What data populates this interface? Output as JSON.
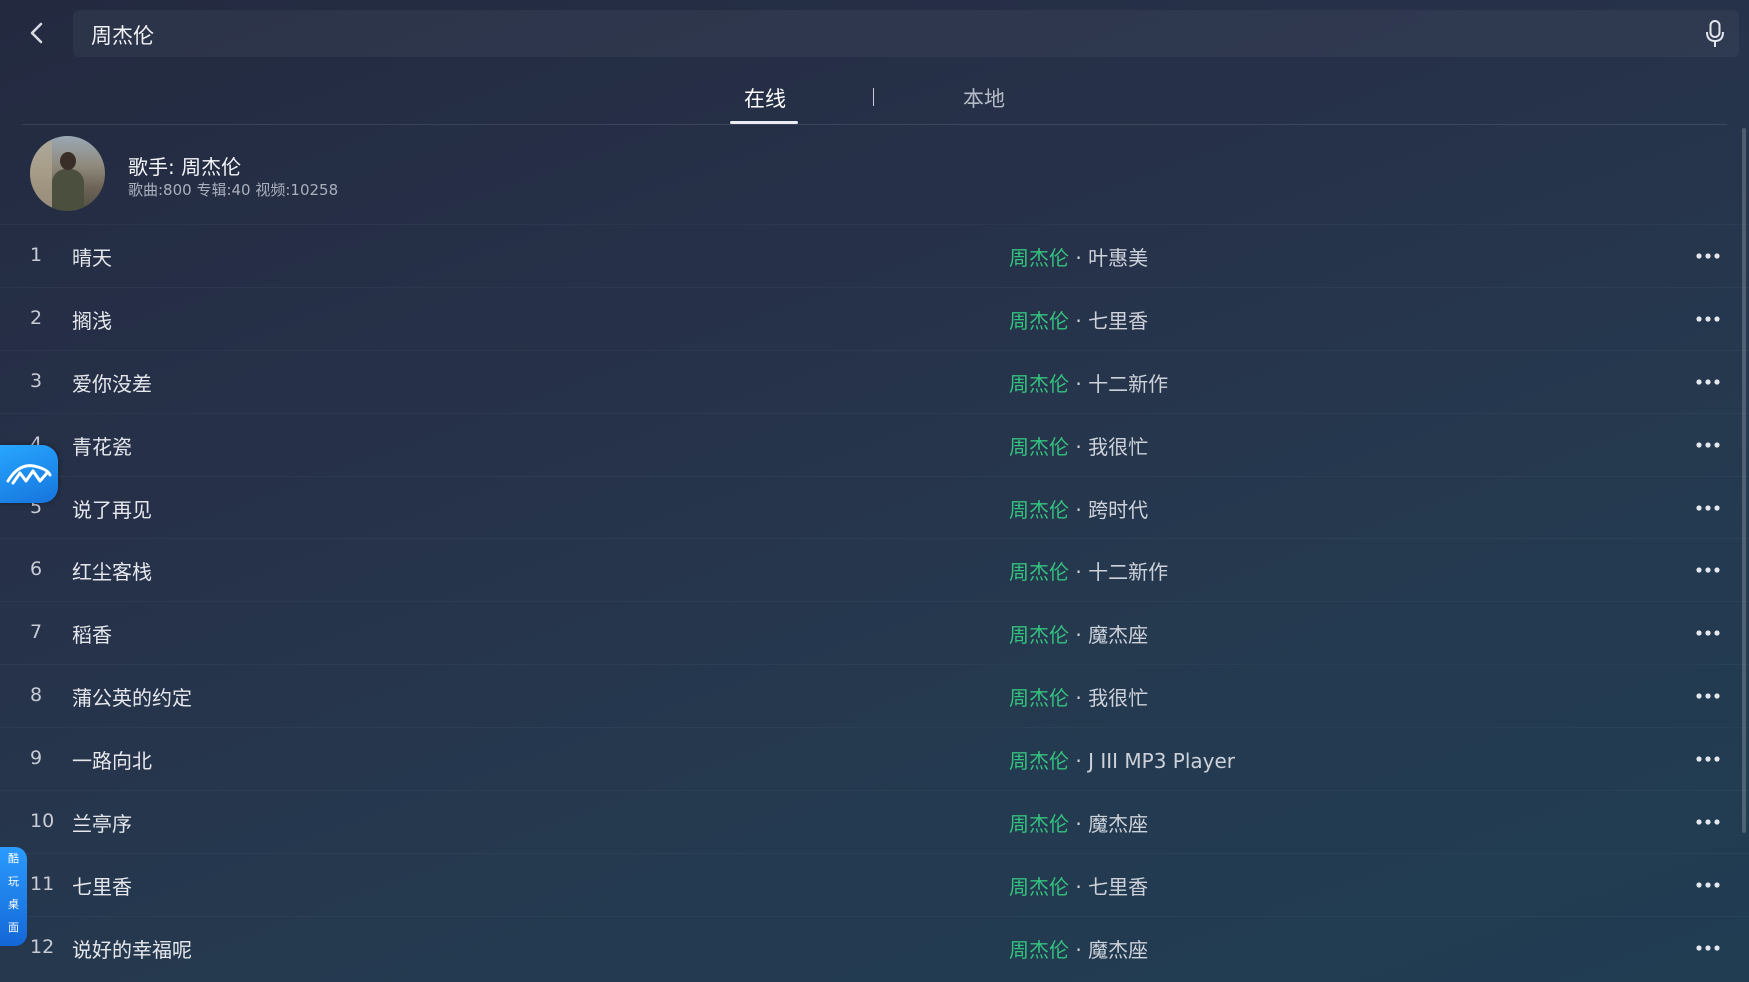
{
  "search": {
    "query": "周杰伦"
  },
  "tabs": [
    {
      "label": "在线"
    },
    {
      "label": "本地"
    }
  ],
  "tab_divider": "|",
  "artist": {
    "title": "歌手: 周杰伦",
    "meta": "歌曲:800 专辑:40 视频:10258"
  },
  "songs": [
    {
      "num": "1",
      "title": "晴天",
      "artist": "周杰伦",
      "album": "叶惠美"
    },
    {
      "num": "2",
      "title": "搁浅",
      "artist": "周杰伦",
      "album": "七里香"
    },
    {
      "num": "3",
      "title": "爱你没差",
      "artist": "周杰伦",
      "album": "十二新作"
    },
    {
      "num": "4",
      "title": "青花瓷",
      "artist": "周杰伦",
      "album": "我很忙"
    },
    {
      "num": "5",
      "title": "说了再见",
      "artist": "周杰伦",
      "album": "跨时代"
    },
    {
      "num": "6",
      "title": "红尘客栈",
      "artist": "周杰伦",
      "album": "十二新作"
    },
    {
      "num": "7",
      "title": "稻香",
      "artist": "周杰伦",
      "album": "魔杰座"
    },
    {
      "num": "8",
      "title": "蒲公英的约定",
      "artist": "周杰伦",
      "album": "我很忙"
    },
    {
      "num": "9",
      "title": "一路向北",
      "artist": "周杰伦",
      "album": "J III MP3 Player"
    },
    {
      "num": "10",
      "title": "兰亭序",
      "artist": "周杰伦",
      "album": "魔杰座"
    },
    {
      "num": "11",
      "title": "七里香",
      "artist": "周杰伦",
      "album": "七里香"
    },
    {
      "num": "12",
      "title": "说好的幸福呢",
      "artist": "周杰伦",
      "album": "魔杰座"
    }
  ],
  "separator": " · ",
  "side_launcher": {
    "chars": [
      "酷",
      "玩",
      "桌",
      "面"
    ]
  },
  "icons": {
    "back": "chevron-left-icon",
    "mic": "microphone-icon",
    "more": "more-dots-icon",
    "float": "floating-app-icon"
  },
  "colors": {
    "accent_artist": "#34c27f",
    "tab_active": "#ffffff",
    "launcher_blue": "#1f86f0"
  }
}
